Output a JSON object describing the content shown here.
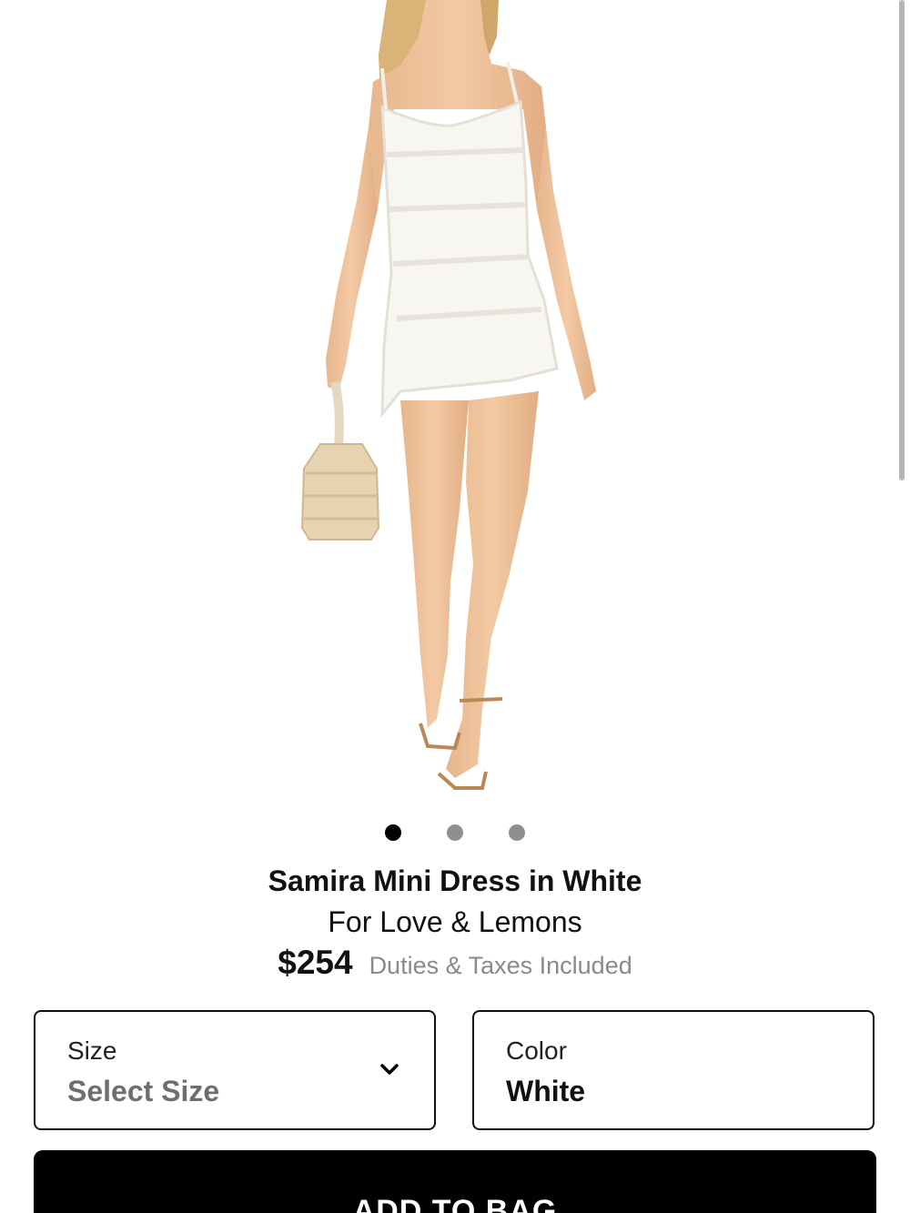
{
  "product": {
    "title": "Samira Mini Dress in White",
    "brand": "For Love & Lemons",
    "price": "$254",
    "duties_note": "Duties & Taxes Included"
  },
  "gallery": {
    "image_count": 3,
    "active_index": 0
  },
  "size_selector": {
    "label": "Size",
    "value": "Select Size",
    "icon": "chevron-down-icon"
  },
  "color_selector": {
    "label": "Color",
    "value": "White"
  },
  "add_to_bag": {
    "label": "ADD TO BAG"
  },
  "colors": {
    "primary": "#000000",
    "muted_text": "#8a8a8a",
    "placeholder_text": "#6f6f6f",
    "dot_inactive": "#8f8f8f"
  }
}
